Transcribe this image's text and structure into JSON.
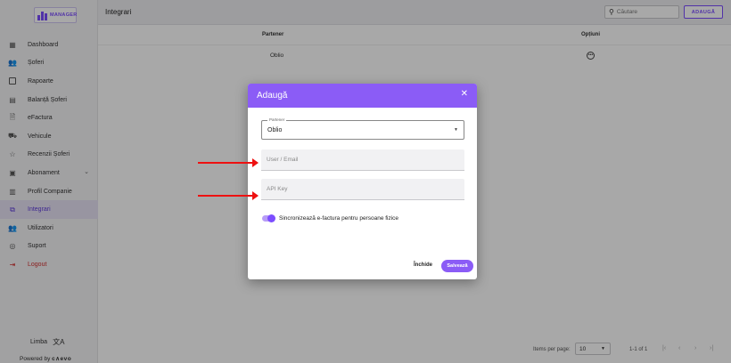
{
  "app": {
    "logo_text": "MANAGER",
    "language_label": "Limba",
    "powered_label": "Powered by",
    "powered_brand": "c∧evo"
  },
  "sidebar": {
    "items": [
      {
        "label": "Dashboard",
        "icon": "dashboard-icon"
      },
      {
        "label": "Șoferi",
        "icon": "drivers-icon"
      },
      {
        "label": "Rapoarte",
        "icon": "reports-icon"
      },
      {
        "label": "Balanță Șoferi",
        "icon": "balance-icon"
      },
      {
        "label": "eFactura",
        "icon": "invoice-icon"
      },
      {
        "label": "Vehicule",
        "icon": "vehicle-icon"
      },
      {
        "label": "Recenzii Șoferi",
        "icon": "reviews-icon"
      },
      {
        "label": "Abonament",
        "icon": "subscription-icon"
      },
      {
        "label": "Profil Companie",
        "icon": "company-icon"
      },
      {
        "label": "Integrari",
        "icon": "integrations-icon"
      },
      {
        "label": "Utilizatori",
        "icon": "users-icon"
      },
      {
        "label": "Suport",
        "icon": "support-icon"
      },
      {
        "label": "Logout",
        "icon": "logout-icon"
      }
    ],
    "active_index": 9
  },
  "header": {
    "title": "Integrari",
    "search_placeholder": "Căutare",
    "add_label": "ADAUGĂ"
  },
  "table": {
    "columns": [
      "Partener",
      "Opțiuni"
    ],
    "rows": [
      {
        "partener": "Oblio"
      }
    ]
  },
  "paginator": {
    "items_per_page_label": "Items per page:",
    "page_size": "10",
    "range_label": "1-1 of 1"
  },
  "modal": {
    "title": "Adaugă",
    "partener_legend": "Partener",
    "partener_value": "Oblio",
    "user_placeholder": "User / Email",
    "api_placeholder": "API Key",
    "toggle_label": "Sincronizează e-factura pentru persoane fizice",
    "toggle_on": true,
    "close_label": "Închide",
    "save_label": "Salvează"
  },
  "colors": {
    "accent": "#8b5cf6",
    "annotation_arrow": "#e11111"
  }
}
